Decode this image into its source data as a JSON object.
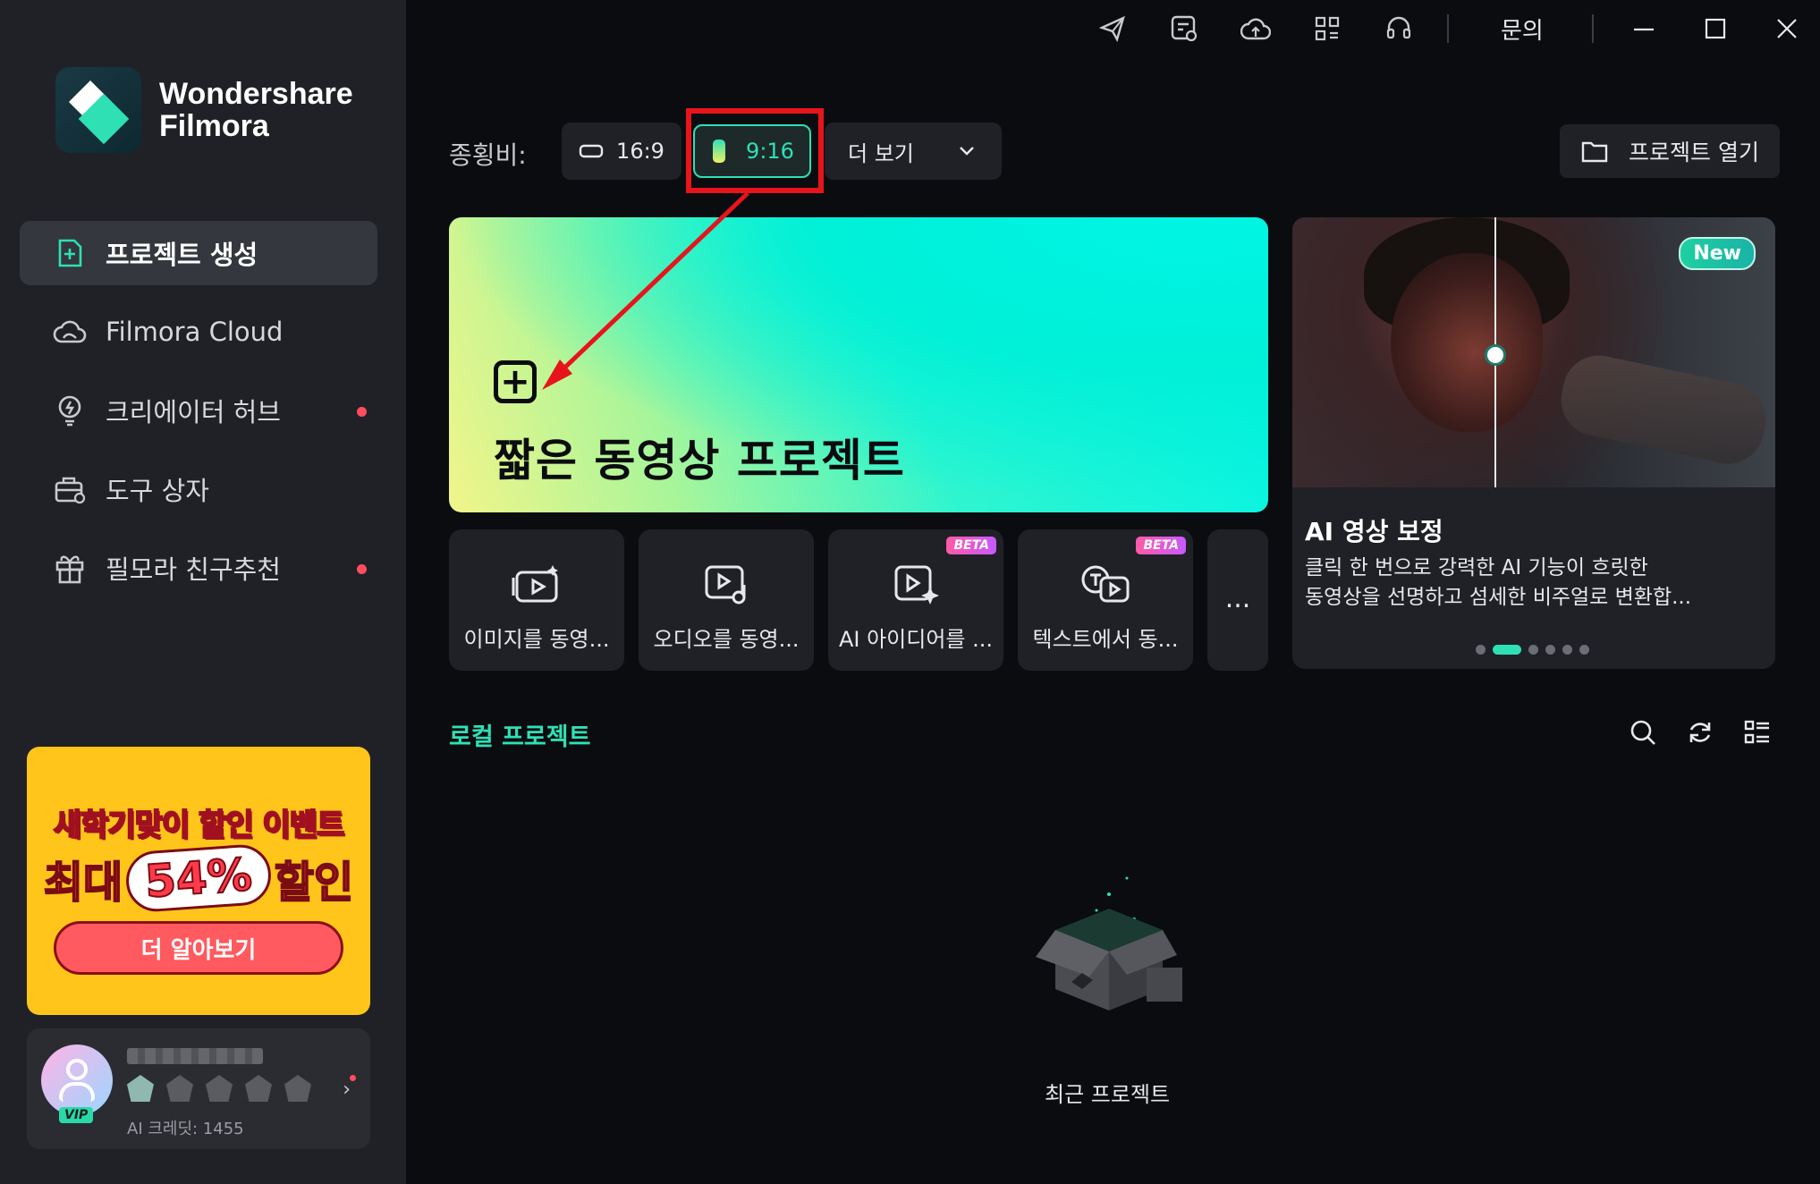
{
  "app": {
    "brand_line1": "Wondershare",
    "brand_line2": "Filmora"
  },
  "sidebar": {
    "items": [
      {
        "label": "프로젝트 생성",
        "icon": "new-project-icon",
        "active": true,
        "dot": false
      },
      {
        "label": "Filmora Cloud",
        "icon": "cloud-icon",
        "active": false,
        "dot": false
      },
      {
        "label": "크리에이터 허브",
        "icon": "lightbulb-icon",
        "active": false,
        "dot": true
      },
      {
        "label": "도구 상자",
        "icon": "toolbox-icon",
        "active": false,
        "dot": false
      },
      {
        "label": "필모라 친구추천",
        "icon": "gift-icon",
        "active": false,
        "dot": true
      }
    ]
  },
  "promo": {
    "line1": "새학기맞이 할인 이벤트",
    "line2_pre": "최대",
    "line2_pct": "54%",
    "line2_post": "할인",
    "button": "더 알아보기"
  },
  "user": {
    "vip": "VIP",
    "credits": "AI 크레딧: 1455"
  },
  "topbar": {
    "inquiry": "문의"
  },
  "ratio": {
    "label": "종횡비:",
    "options": [
      "16:9",
      "9:16"
    ],
    "selected": "9:16",
    "more": "더 보기",
    "open_project": "프로젝트 열기"
  },
  "hero": {
    "title": "짧은 동영상 프로젝트"
  },
  "tools": [
    {
      "label": "이미지를 동영...",
      "beta": false
    },
    {
      "label": "오디오를 동영...",
      "beta": false
    },
    {
      "label": "AI 아이디어를 ...",
      "beta": true
    },
    {
      "label": "텍스트에서 동...",
      "beta": true
    }
  ],
  "tools_more": "...",
  "beta_label": "BETA",
  "ai_card": {
    "badge": "New",
    "title": "AI 영상 보정",
    "desc_line1": "클릭 한 번으로 강력한 AI 기능이 흐릿한",
    "desc_line2": "동영상을 선명하고 섬세한 비주얼로 변환합...",
    "slide_count": 6,
    "active_slide": 2
  },
  "local": {
    "title": "로컬 프로젝트",
    "empty": "최근 프로젝트"
  },
  "colors": {
    "accent": "#2fe0b5",
    "highlight": "#e8141c",
    "sidebar_bg": "#1f2126",
    "main_bg": "#0b0c0f"
  }
}
